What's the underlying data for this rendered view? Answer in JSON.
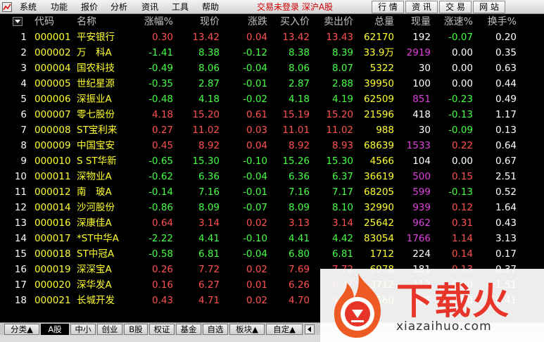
{
  "menu": {
    "items": [
      "系统",
      "功能",
      "报价",
      "分析",
      "资讯",
      "工具",
      "帮助"
    ],
    "status": "交易未登录  深沪A股",
    "right_buttons": [
      "行 情",
      "资 讯",
      "交 易",
      "网 站"
    ]
  },
  "table": {
    "headers": [
      "代码",
      "名称",
      "涨幅%",
      "现价",
      "涨跌",
      "买入价",
      "卖出价",
      "总量",
      "现量",
      "涨速%",
      "换手%"
    ],
    "rows": [
      [
        "1",
        "000001",
        "平安银行",
        "0.30",
        "13.42",
        "0.04",
        "13.42",
        "13.43",
        "62170",
        "192",
        "-0.07",
        "0.20"
      ],
      [
        "2",
        "000002",
        "万　科A",
        "-1.41",
        "8.38",
        "-0.12",
        "8.38",
        "8.39",
        "33.9万",
        "2919",
        "0.00",
        "0.35"
      ],
      [
        "3",
        "000004",
        "国农科技",
        "-0.49",
        "8.06",
        "-0.04",
        "8.06",
        "8.07",
        "5322",
        "30",
        "0.00",
        "0.63"
      ],
      [
        "4",
        "000005",
        "世纪星源",
        "-0.35",
        "2.87",
        "-0.01",
        "2.87",
        "2.88",
        "39950",
        "100",
        "0.00",
        "0.44"
      ],
      [
        "5",
        "000006",
        "深振业A",
        "-0.48",
        "4.18",
        "-0.02",
        "4.18",
        "4.19",
        "62509",
        "851",
        "-0.23",
        "0.49"
      ],
      [
        "6",
        "000007",
        "零七股份",
        "4.18",
        "15.20",
        "0.61",
        "15.19",
        "15.20",
        "21596",
        "418",
        "-0.13",
        "1.17"
      ],
      [
        "7",
        "000008",
        "ST宝利来",
        "0.27",
        "11.02",
        "0.03",
        "11.01",
        "11.02",
        "988",
        "30",
        "-0.09",
        "0.13"
      ],
      [
        "8",
        "000009",
        "中国宝安",
        "0.45",
        "8.92",
        "0.04",
        "8.92",
        "8.93",
        "68639",
        "1533",
        "0.22",
        "0.64"
      ],
      [
        "9",
        "000010",
        "S ST华新",
        "-0.65",
        "15.30",
        "-0.10",
        "15.26",
        "15.30",
        "4566",
        "104",
        "0.00",
        "0.67"
      ],
      [
        "10",
        "000011",
        "深物业A",
        "-0.62",
        "6.36",
        "-0.04",
        "6.36",
        "6.37",
        "36619",
        "500",
        "0.15",
        "2.51"
      ],
      [
        "11",
        "000012",
        "南　玻A",
        "-0.14",
        "7.16",
        "-0.01",
        "7.16",
        "7.17",
        "68205",
        "599",
        "-0.13",
        "0.52"
      ],
      [
        "12",
        "000014",
        "沙河股份",
        "-0.86",
        "8.09",
        "-0.07",
        "8.09",
        "8.10",
        "32990",
        "939",
        "0.12",
        "1.64"
      ],
      [
        "13",
        "000016",
        "深康佳A",
        "0.64",
        "3.14",
        "0.02",
        "3.13",
        "3.14",
        "25642",
        "962",
        "0.31",
        "0.43"
      ],
      [
        "14",
        "000017",
        "*ST中华A",
        "-2.22",
        "4.41",
        "-0.10",
        "4.41",
        "4.42",
        "83054",
        "1766",
        "1.14",
        "3.13"
      ],
      [
        "15",
        "000018",
        "ST中冠A",
        "-0.58",
        "6.81",
        "-0.04",
        "6.80",
        "6.81",
        "1712",
        "224",
        "0.14",
        "0.17"
      ],
      [
        "16",
        "000019",
        "深深宝A",
        "0.26",
        "7.72",
        "0.02",
        "7.69",
        "7.72",
        "6978",
        "181",
        "0.13",
        "0.37"
      ],
      [
        "17",
        "000020",
        "深华发A",
        "0.16",
        "6.27",
        "0.01",
        "6.26",
        "6.27",
        "3712",
        "113",
        "0.00",
        "1.51"
      ],
      [
        "18",
        "000021",
        "长城开发",
        "0.43",
        "4.71",
        "0.02",
        "4.70",
        "4.71",
        "8660",
        "103",
        "0.00",
        "0.41"
      ]
    ]
  },
  "tabs": [
    {
      "label": "分类▲"
    },
    {
      "label": "A股"
    },
    {
      "label": "中小"
    },
    {
      "label": "创业"
    },
    {
      "label": "B股"
    },
    {
      "label": "权证"
    },
    {
      "label": "基金"
    },
    {
      "label": "自选"
    },
    {
      "label": "板块▲"
    },
    {
      "label": "自定▲"
    }
  ],
  "active_tab": 1,
  "watermark": {
    "title": "下载火",
    "url": "xiazaihuo.com"
  },
  "colors": {
    "up": "#ff5050",
    "down": "#44ff44",
    "flat": "#ffffff",
    "code": "#ffff30",
    "volume_highlight": "#e040e0",
    "background": "#000000"
  }
}
